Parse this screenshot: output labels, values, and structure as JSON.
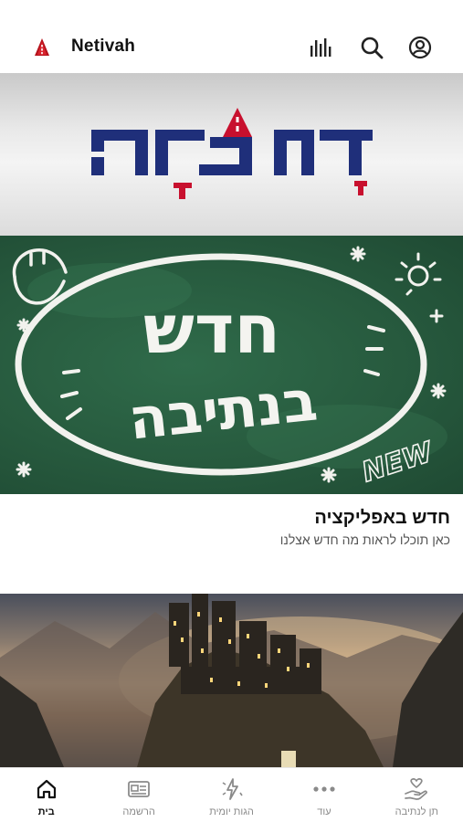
{
  "header": {
    "app_name": "Netivah",
    "icons": [
      "logo-icon",
      "stats-icon",
      "search-icon",
      "account-icon"
    ]
  },
  "banner": {
    "logo_text": "נְתִיבָה",
    "colors": {
      "logo_blue": "#1f2f7a",
      "logo_red": "#c8102e"
    }
  },
  "chalkboard": {
    "line1": "חדש",
    "line2": "בנתיבה",
    "tag": "NEW",
    "color": "#2b6344"
  },
  "articles": [
    {
      "title": "חדש באפליקציה",
      "subtitle": "כאן תוכלו לראות מה חדש אצלנו"
    }
  ],
  "bottom_nav": {
    "items": [
      {
        "label": "בית",
        "icon": "home-icon",
        "active": true
      },
      {
        "label": "הרשמה",
        "icon": "registration-icon",
        "active": false
      },
      {
        "label": "הגות יומית",
        "icon": "daily-thought-icon",
        "active": false
      },
      {
        "label": "עוד",
        "icon": "more-icon",
        "active": false
      },
      {
        "label": "תן לנתיבה",
        "icon": "donate-icon",
        "active": false
      }
    ]
  }
}
